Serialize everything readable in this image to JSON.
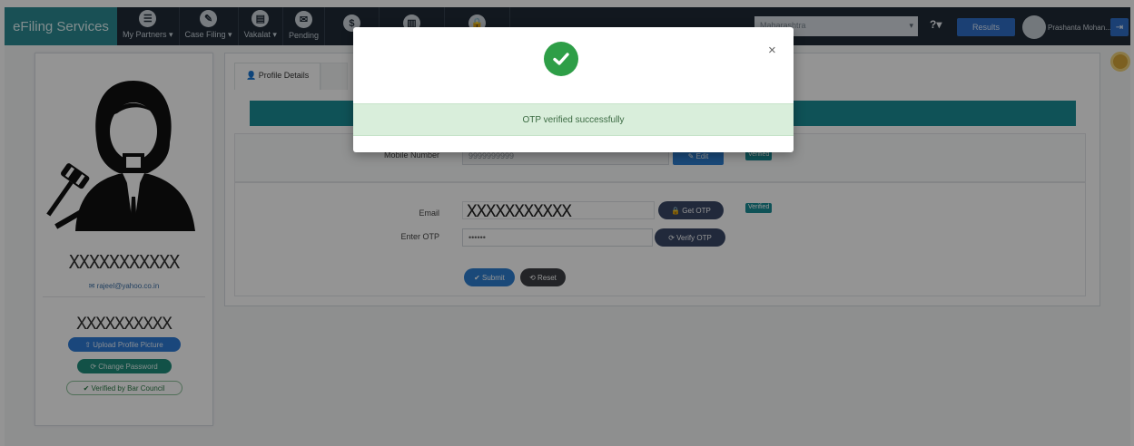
{
  "nav": {
    "brand": "eFiling Services",
    "items": [
      {
        "label": "My Partners ▾"
      },
      {
        "label": "Case Filing ▾"
      },
      {
        "label": "Vakalat ▾"
      },
      {
        "label": "Pending"
      },
      {
        "label": ""
      },
      {
        "label": ""
      },
      {
        "label": ""
      }
    ],
    "state_select": "Maharashtra",
    "help_label": "?▾",
    "button_label": "Results",
    "user_name": "Prashanta Mohan...",
    "logout_label": "⇥"
  },
  "profile": {
    "name": "XXXXXXXXXXX",
    "email": "✉ rajeel@yahoo.co.in",
    "name_2": "XXXXXXXXXX",
    "upload_btn": "⇧ Upload Profile Picture",
    "change_pw_btn": "⟳ Change Password",
    "verified_badge": "✔ Verified by Bar Council"
  },
  "tabs": {
    "profile_details": "👤 Profile Details",
    "other": ""
  },
  "form": {
    "mobile_label": "Mobile Number",
    "mobile_value": "9999999999",
    "mobile_btn": "✎ Edit",
    "mobile_tag": "Verified",
    "email_label": "Email",
    "email_value": "XXXXXXXXXXX",
    "get_otp_btn": "🔒 Get OTP",
    "email_tag": "Verified",
    "otp_label": "Enter OTP",
    "otp_value": "••••••",
    "verify_otp_btn": "⟳ Verify OTP",
    "submit_btn": "✔ Submit",
    "reset_btn": "⟲ Reset"
  },
  "modal": {
    "close": "×",
    "message": "OTP verified successfully"
  },
  "colors": {
    "teal": "#1b8d96",
    "success": "#2e9e47",
    "nav_dark": "#1f2a36"
  }
}
